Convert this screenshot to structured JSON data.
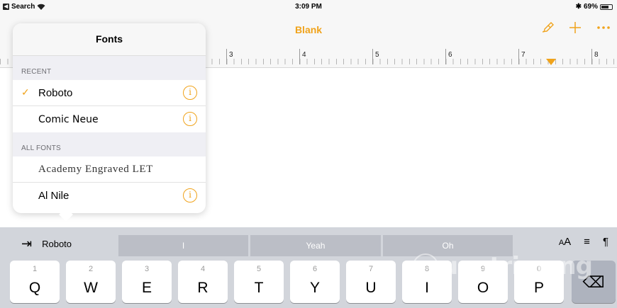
{
  "status_bar": {
    "back_label": "Search",
    "time": "3:09 PM",
    "bluetooth": "✱",
    "battery": "69%",
    "battery_level": 0.69
  },
  "toolbar": {
    "title": "Blank",
    "accent_color": "#f0a31b",
    "icons": [
      "paintbrush-icon",
      "plus-icon",
      "more-icon"
    ]
  },
  "ruler": {
    "numbers": [
      "3",
      "4",
      "5",
      "6",
      "7",
      "8"
    ]
  },
  "popover": {
    "title": "Fonts",
    "recent_header": "RECENT",
    "all_header": "ALL FONTS",
    "recent": [
      {
        "name": "Roboto",
        "selected": true,
        "info": true
      },
      {
        "name": "Comic Neue",
        "selected": false,
        "info": true
      }
    ],
    "all": [
      {
        "name": "Academy Engraved LET",
        "info": false
      },
      {
        "name": "Al Nile",
        "info": true
      }
    ],
    "check_glyph": "✓",
    "info_glyph": "i"
  },
  "shortcut_bar": {
    "tab_glyph": "⇥",
    "font_name": "Roboto",
    "suggestions": [
      "I",
      "Yeah",
      "Oh"
    ],
    "text_size_small": "A",
    "text_size_large": "A",
    "align_glyph": "≡",
    "paragraph_glyph": "¶"
  },
  "keyboard": {
    "keys": [
      {
        "num": "1",
        "letter": "Q"
      },
      {
        "num": "2",
        "letter": "W"
      },
      {
        "num": "3",
        "letter": "E"
      },
      {
        "num": "4",
        "letter": "R"
      },
      {
        "num": "5",
        "letter": "T"
      },
      {
        "num": "6",
        "letter": "Y"
      },
      {
        "num": "7",
        "letter": "U"
      },
      {
        "num": "8",
        "letter": "I"
      },
      {
        "num": "9",
        "letter": "O"
      },
      {
        "num": "0",
        "letter": "P"
      }
    ],
    "delete_glyph": "⌫"
  },
  "watermark": {
    "text": "uantrimang"
  }
}
